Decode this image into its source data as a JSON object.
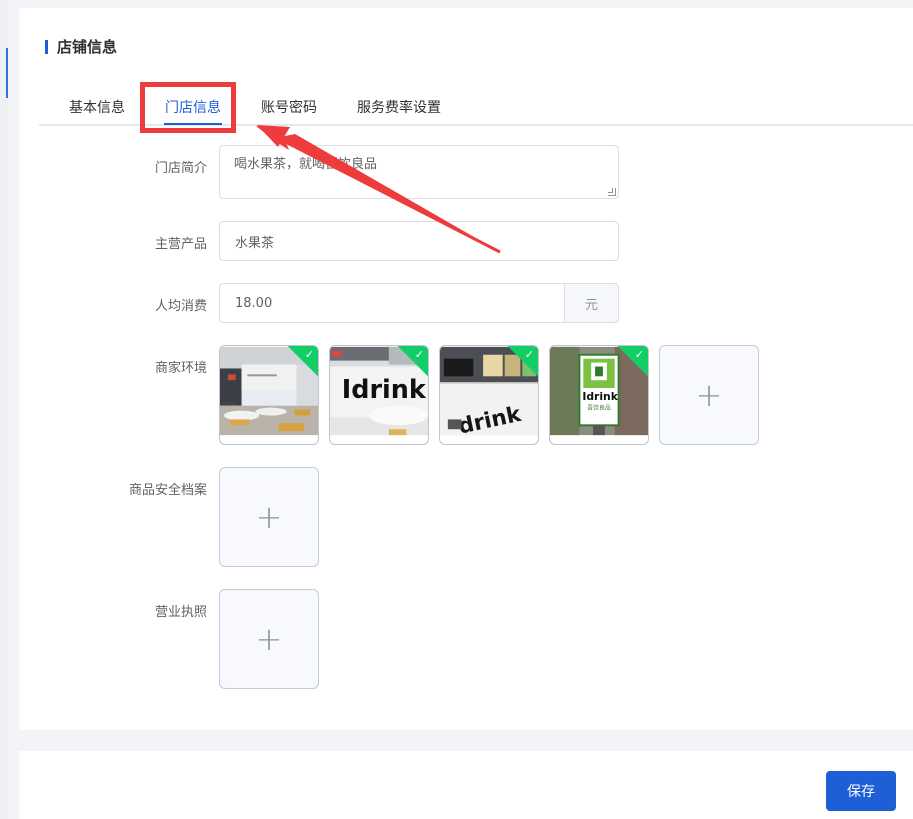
{
  "section": {
    "title": "店铺信息"
  },
  "tabs": [
    {
      "label": "基本信息"
    },
    {
      "label": "门店信息"
    },
    {
      "label": "账号密码"
    },
    {
      "label": "服务费率设置"
    }
  ],
  "form": {
    "intro_label": "门店简介",
    "intro_value": "喝水果茶，就喝吾饮良品",
    "product_label": "主营产品",
    "product_value": "水果茶",
    "avg_label": "人均消费",
    "avg_value": "18.00",
    "avg_unit": "元",
    "env_label": "商家环境",
    "safety_label": "商品安全档案",
    "license_label": "营业执照"
  },
  "gallery": {
    "images": [
      {
        "caption": ""
      },
      {
        "caption": "Idrink"
      },
      {
        "caption": "drink"
      },
      {
        "caption": "Idrink"
      },
      {
        "caption": "吾饮良品"
      }
    ],
    "upload_icon": "plus-icon"
  },
  "footer": {
    "save_label": "保存"
  },
  "colors": {
    "accent": "#1f5fd6",
    "annotation": "#ee3b3b",
    "success": "#13ce66"
  }
}
